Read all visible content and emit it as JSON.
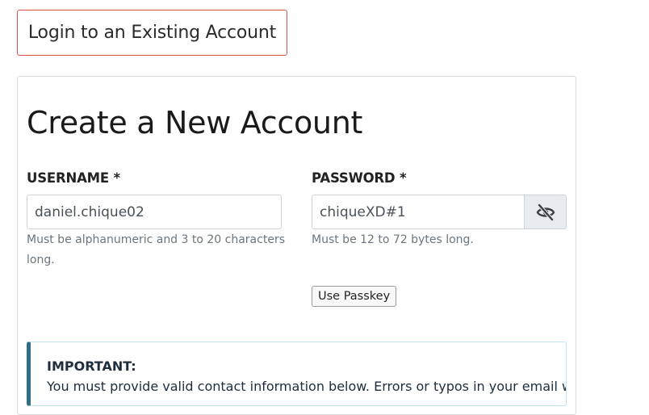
{
  "login_button": {
    "label": "Login to an Existing Account"
  },
  "form": {
    "title": "Create a New Account",
    "username": {
      "label": "USERNAME *",
      "value": "daniel.chique02",
      "help": "Must be alphanumeric and 3 to 20 characters long."
    },
    "password": {
      "label": "PASSWORD *",
      "value": "chiqueXD#1",
      "help": "Must be 12 to 72 bytes long.",
      "toggle_icon": "eye-slash-icon"
    },
    "passkey_button": {
      "label": "Use Passkey"
    }
  },
  "notice": {
    "title": "IMPORTANT:",
    "body": "You must provide valid contact information below. Errors or typos in your email will be"
  },
  "colors": {
    "login_border": "#d9534f",
    "alert_accent": "#2f6f85",
    "alert_border": "#bee5eb"
  }
}
